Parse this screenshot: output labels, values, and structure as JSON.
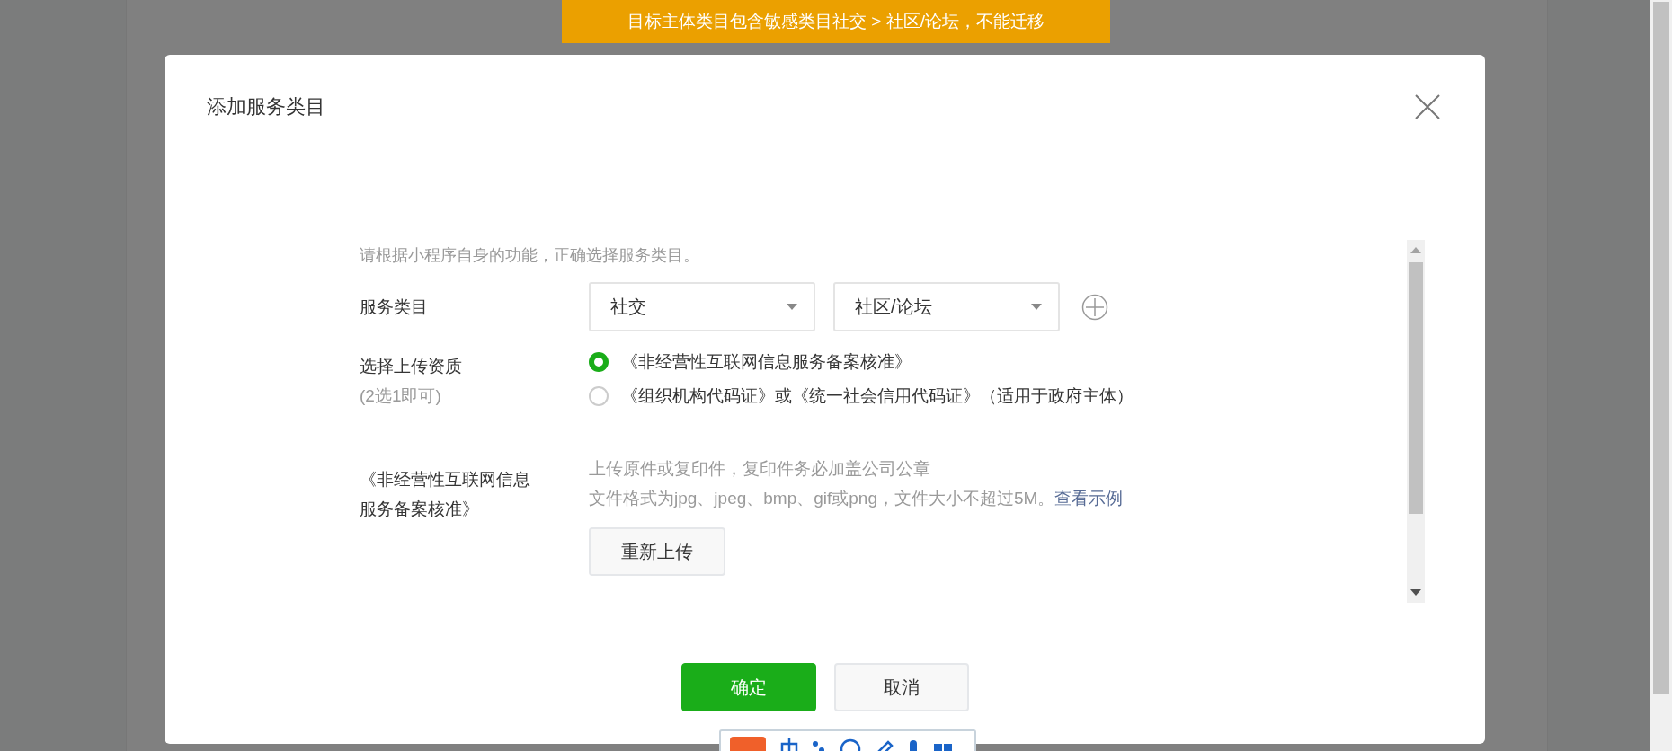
{
  "banner": {
    "text": "目标主体类目包含敏感类目社交 > 社区/论坛，不能迁移"
  },
  "dialog": {
    "title": "添加服务类目",
    "hint": "请根据小程序自身的功能，正确选择服务类目。",
    "category": {
      "label": "服务类目",
      "selects": [
        {
          "value": "社交"
        },
        {
          "value": "社区/论坛"
        }
      ]
    },
    "qualification": {
      "label": "选择上传资质",
      "sublabel": "(2选1即可)",
      "options": [
        {
          "text": "《非经营性互联网信息服务备案核准》",
          "selected": true
        },
        {
          "text": "《组织机构代码证》或《统一社会信用代码证》（适用于政府主体）",
          "selected": false
        }
      ]
    },
    "upload": {
      "label_lines": [
        "《非经营性互联网信息",
        "服务备案核准》"
      ],
      "note": "上传原件或复印件，复印件务必加盖公司公章",
      "format": "文件格式为jpg、jpeg、bmp、gif或png，文件大小不超过5M。",
      "example_link": "查看示例",
      "button": "重新上传"
    },
    "buttons": [
      {
        "label": "确定",
        "kind": "primary"
      },
      {
        "label": "取消",
        "kind": "secondary"
      }
    ]
  }
}
